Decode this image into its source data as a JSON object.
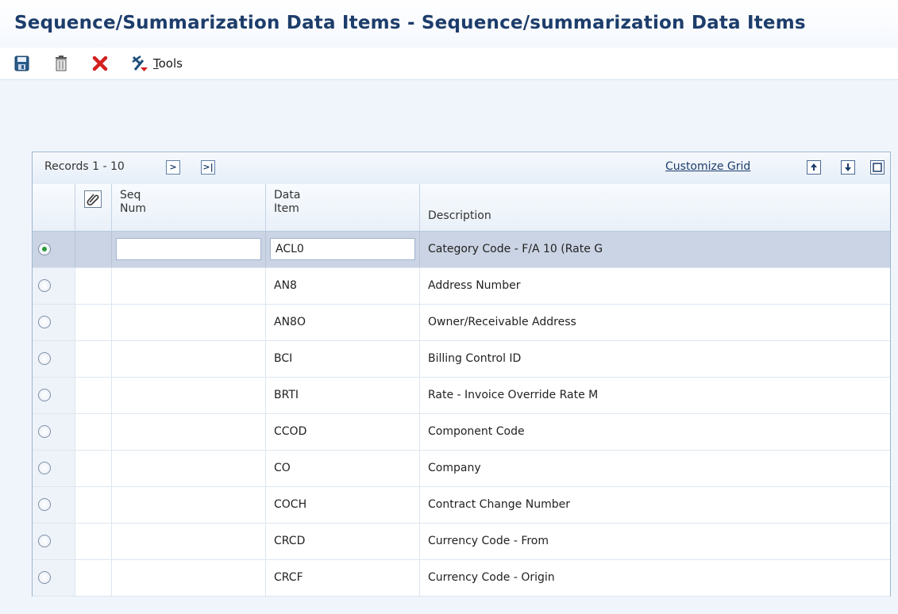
{
  "page": {
    "title": "Sequence/Summarization Data Items - Sequence/summarization Data Items"
  },
  "toolbar": {
    "save_icon": "save-icon",
    "delete_icon": "trash-icon",
    "cancel_icon": "close-icon",
    "tools_icon": "tools-icon",
    "tools_label_first": "T",
    "tools_label_rest": "ools"
  },
  "grid": {
    "records_label": "Records 1 - 10",
    "next_icon": "next-page-icon",
    "last_icon": "last-page-icon",
    "customize_label": "Customize Grid",
    "export_icon": "export-icon",
    "import_icon": "import-icon",
    "maximize_icon": "maximize-icon",
    "columns": {
      "attach_icon": "attachment-icon",
      "seq_num_line1": "Seq",
      "seq_num_line2": "Num",
      "data_item_line1": "Data",
      "data_item_line2": "Item",
      "description": "Description"
    },
    "rows": [
      {
        "selected": true,
        "seq_num": "",
        "data_item": "ACL0",
        "description": "Category Code - F/A 10 (Rate G"
      },
      {
        "selected": false,
        "seq_num": "",
        "data_item": "AN8",
        "description": "Address Number"
      },
      {
        "selected": false,
        "seq_num": "",
        "data_item": "AN8O",
        "description": "Owner/Receivable Address"
      },
      {
        "selected": false,
        "seq_num": "",
        "data_item": "BCI",
        "description": "Billing Control ID"
      },
      {
        "selected": false,
        "seq_num": "",
        "data_item": "BRTI",
        "description": "Rate - Invoice Override Rate M"
      },
      {
        "selected": false,
        "seq_num": "",
        "data_item": "CCOD",
        "description": "Component Code"
      },
      {
        "selected": false,
        "seq_num": "",
        "data_item": "CO",
        "description": "Company"
      },
      {
        "selected": false,
        "seq_num": "",
        "data_item": "COCH",
        "description": "Contract Change Number"
      },
      {
        "selected": false,
        "seq_num": "",
        "data_item": "CRCD",
        "description": "Currency Code - From"
      },
      {
        "selected": false,
        "seq_num": "",
        "data_item": "CRCF",
        "description": "Currency Code - Origin"
      }
    ]
  },
  "colors": {
    "title": "#1d3d6b",
    "selected_row": "#cbd4e4",
    "radio_selected_dot": "#2b9a3a",
    "cancel_red": "#d32020"
  }
}
